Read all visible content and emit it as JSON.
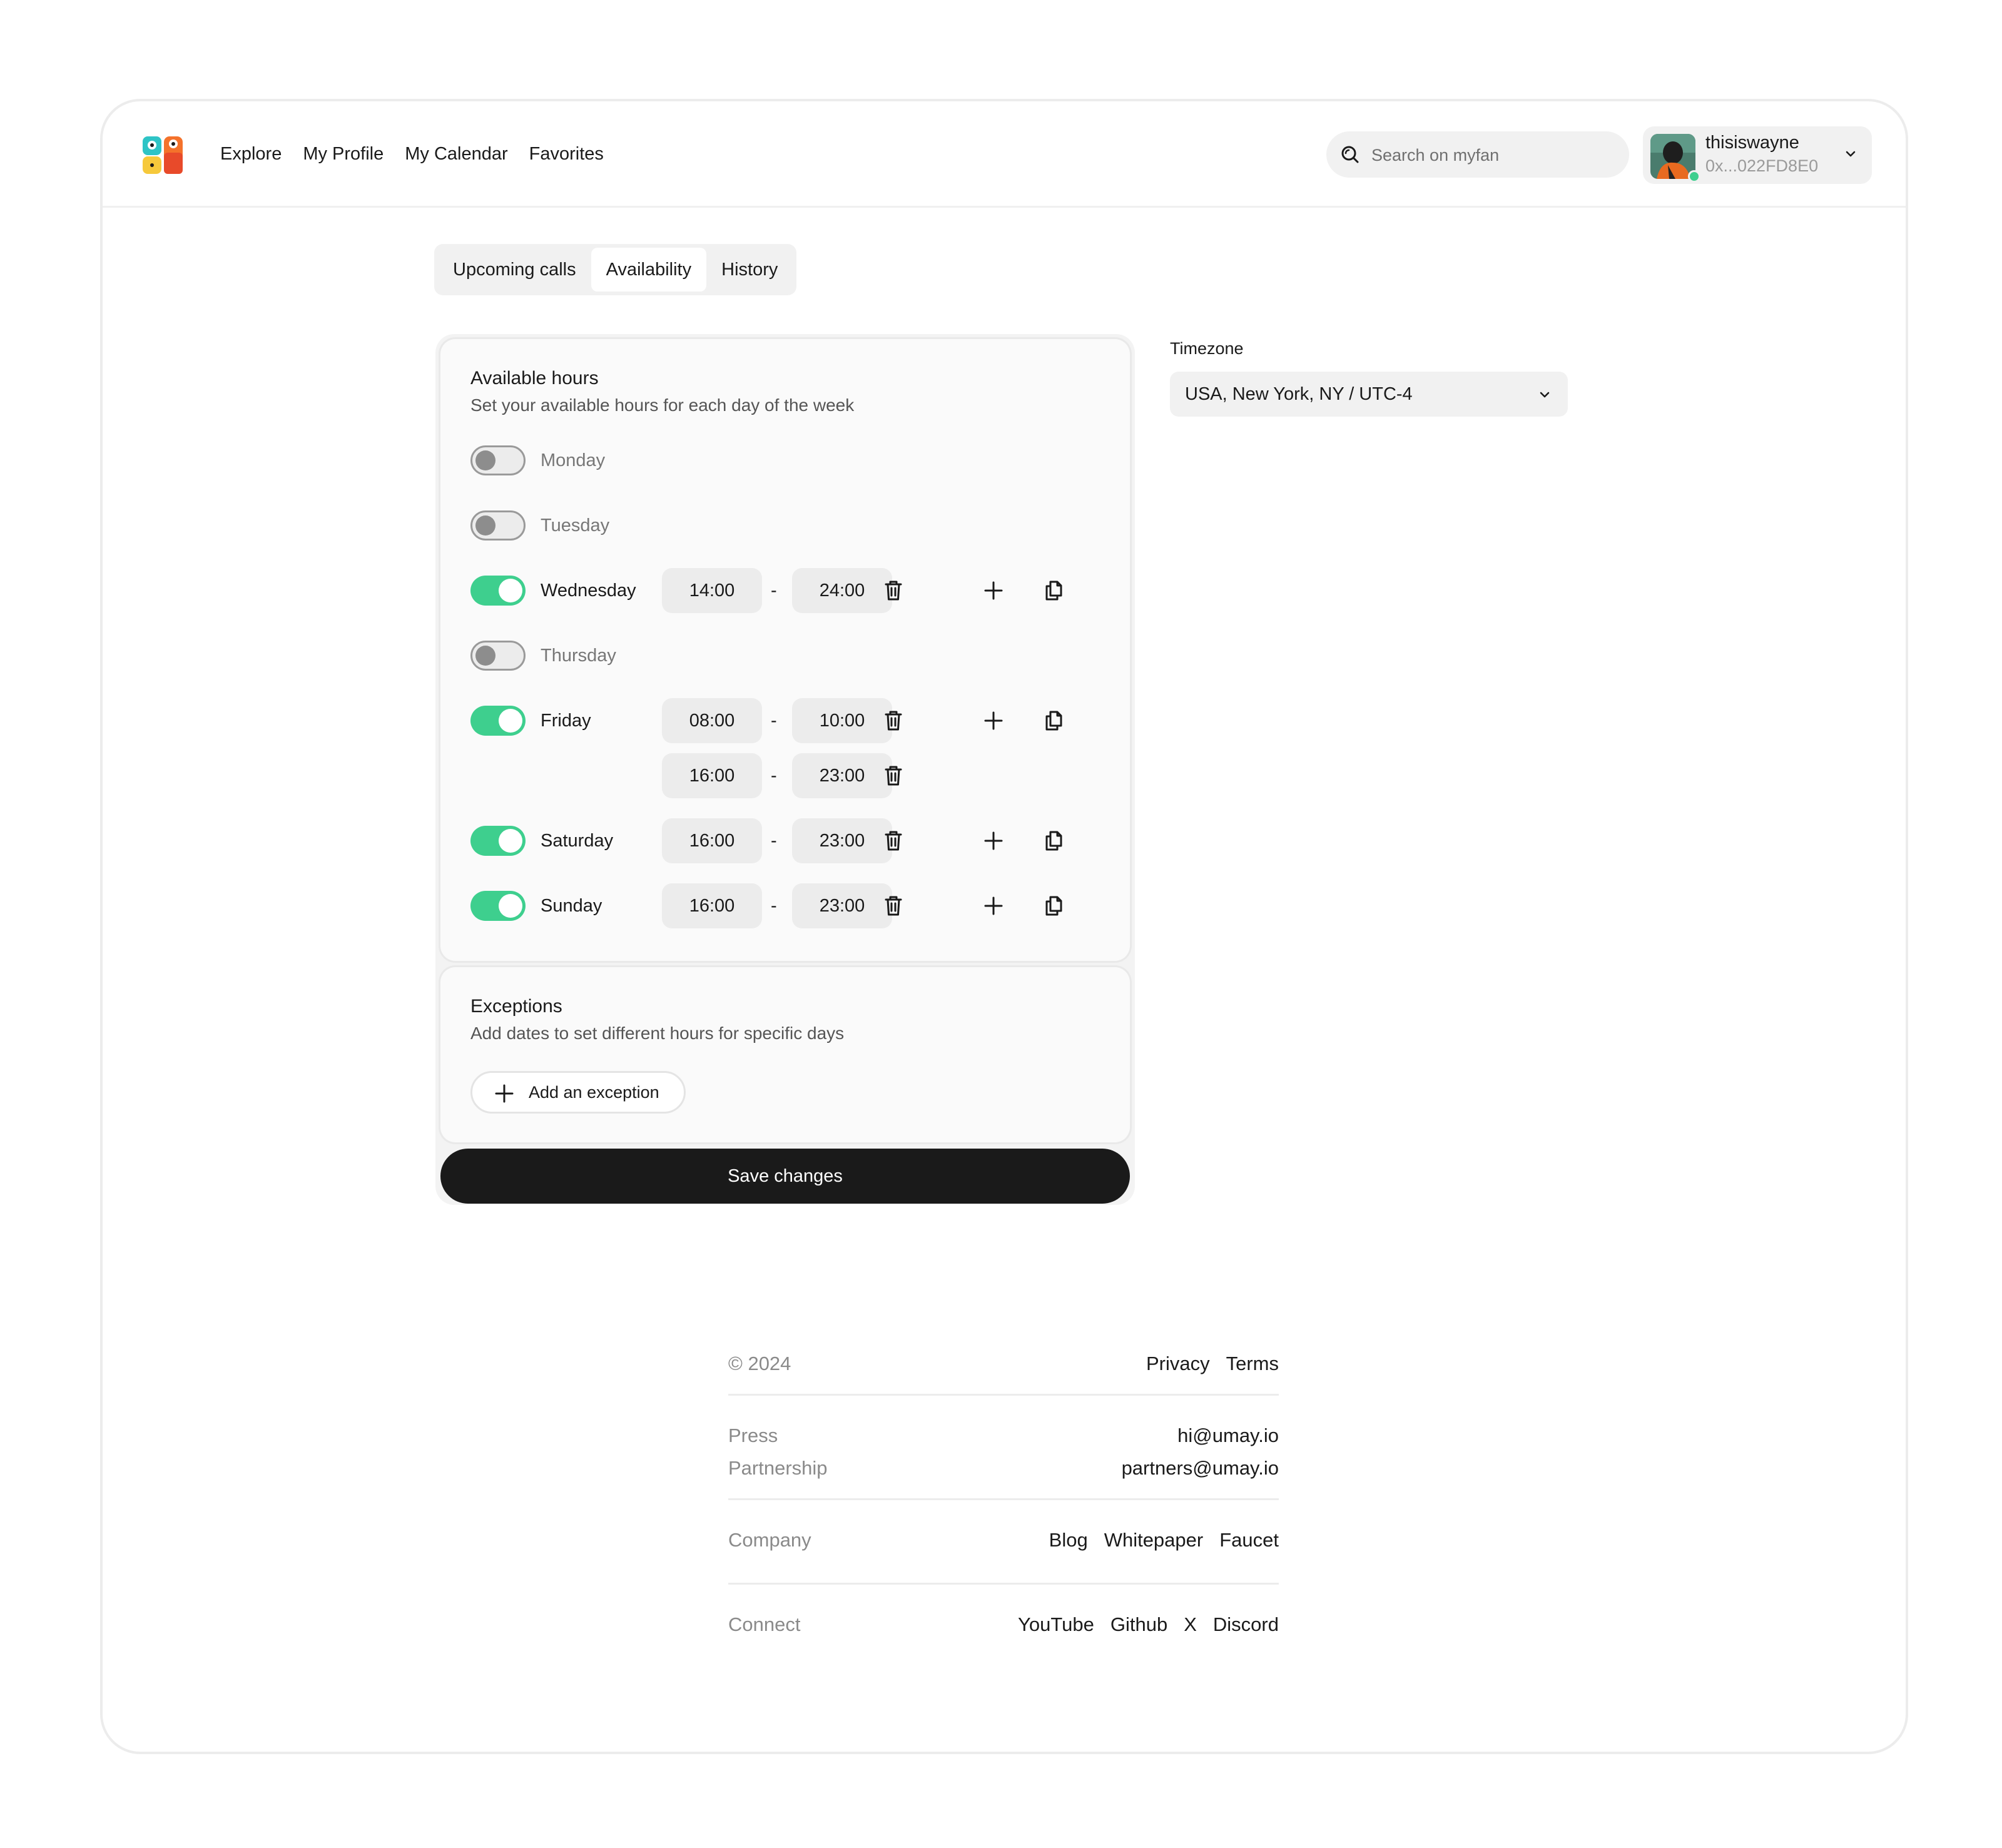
{
  "nav": {
    "items": [
      "Explore",
      "My Profile",
      "My Calendar",
      "Favorites"
    ]
  },
  "search": {
    "placeholder": "Search on myfan"
  },
  "user": {
    "name": "thisiswayne",
    "address": "0x...022FD8E0",
    "status": "online"
  },
  "tabs": [
    {
      "label": "Upcoming calls",
      "active": false
    },
    {
      "label": "Availability",
      "active": true
    },
    {
      "label": "History",
      "active": false
    }
  ],
  "hours": {
    "title": "Available hours",
    "subtitle": "Set your available hours for each day of the week",
    "days": [
      {
        "day": "Monday",
        "enabled": false,
        "slots": []
      },
      {
        "day": "Tuesday",
        "enabled": false,
        "slots": []
      },
      {
        "day": "Wednesday",
        "enabled": true,
        "slots": [
          {
            "start": "14:00",
            "end": "24:00"
          }
        ]
      },
      {
        "day": "Thursday",
        "enabled": false,
        "slots": []
      },
      {
        "day": "Friday",
        "enabled": true,
        "slots": [
          {
            "start": "08:00",
            "end": "10:00"
          },
          {
            "start": "16:00",
            "end": "23:00"
          }
        ]
      },
      {
        "day": "Saturday",
        "enabled": true,
        "slots": [
          {
            "start": "16:00",
            "end": "23:00"
          }
        ]
      },
      {
        "day": "Sunday",
        "enabled": true,
        "slots": [
          {
            "start": "16:00",
            "end": "23:00"
          }
        ]
      }
    ],
    "separator": "-"
  },
  "exceptions": {
    "title": "Exceptions",
    "subtitle": "Add dates to set different hours for specific days",
    "add_label": "Add an exception"
  },
  "save_label": "Save changes",
  "timezone": {
    "label": "Timezone",
    "value": "USA, New York, NY / UTC-4"
  },
  "footer": {
    "copyright": "© 2024",
    "legal": [
      "Privacy",
      "Terms"
    ],
    "contacts": [
      {
        "label": "Press",
        "value": "hi@umay.io"
      },
      {
        "label": "Partnership",
        "value": "partners@umay.io"
      }
    ],
    "company": {
      "label": "Company",
      "links": [
        "Blog",
        "Whitepaper",
        "Faucet"
      ]
    },
    "connect": {
      "label": "Connect",
      "links": [
        "YouTube",
        "Github",
        "X",
        "Discord"
      ]
    }
  },
  "colors": {
    "accent": "#3ecf8e",
    "dark": "#1a1a1a"
  }
}
